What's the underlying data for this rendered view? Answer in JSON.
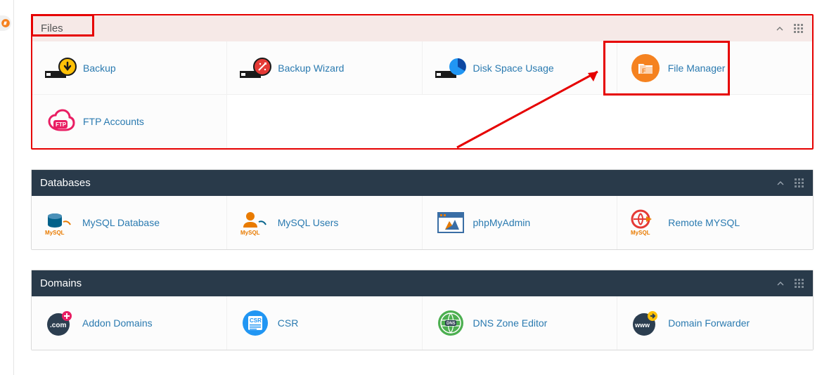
{
  "sidebar": {
    "badge_icon": "cpanel-icon"
  },
  "panels": {
    "files": {
      "title": "Files",
      "items": [
        {
          "label": "Backup",
          "icon": "backup-icon"
        },
        {
          "label": "Backup Wizard",
          "icon": "backup-wizard-icon"
        },
        {
          "label": "Disk Space Usage",
          "icon": "disk-usage-icon"
        },
        {
          "label": "File Manager",
          "icon": "file-manager-icon",
          "highlighted": true
        },
        {
          "label": "FTP Accounts",
          "icon": "ftp-accounts-icon"
        }
      ]
    },
    "databases": {
      "title": "Databases",
      "items": [
        {
          "label": "MySQL Database",
          "icon": "mysql-database-icon"
        },
        {
          "label": "MySQL Users",
          "icon": "mysql-users-icon"
        },
        {
          "label": "phpMyAdmin",
          "icon": "phpmyadmin-icon"
        },
        {
          "label": "Remote MYSQL",
          "icon": "remote-mysql-icon"
        }
      ]
    },
    "domains": {
      "title": "Domains",
      "items": [
        {
          "label": "Addon Domains",
          "icon": "addon-domains-icon"
        },
        {
          "label": "CSR",
          "icon": "csr-icon"
        },
        {
          "label": "DNS Zone Editor",
          "icon": "dns-zone-editor-icon"
        },
        {
          "label": "Domain Forwarder",
          "icon": "domain-forwarder-icon"
        }
      ]
    }
  },
  "annotations": {
    "highlight_title": true,
    "highlight_file_manager": true,
    "arrow_to_file_manager": true
  },
  "colors": {
    "link": "#2a7ab0",
    "dark_header": "#293a4a",
    "files_header": "#f6e9e7",
    "highlight": "#e60000",
    "orange": "#f58220",
    "mysql_orange": "#e97b00",
    "mysql_blue": "#00618a",
    "green": "#4caf50",
    "blue_circle": "#2196f3",
    "pink": "#e91e63",
    "navy": "#2c3e50",
    "yellow": "#ffc107"
  }
}
